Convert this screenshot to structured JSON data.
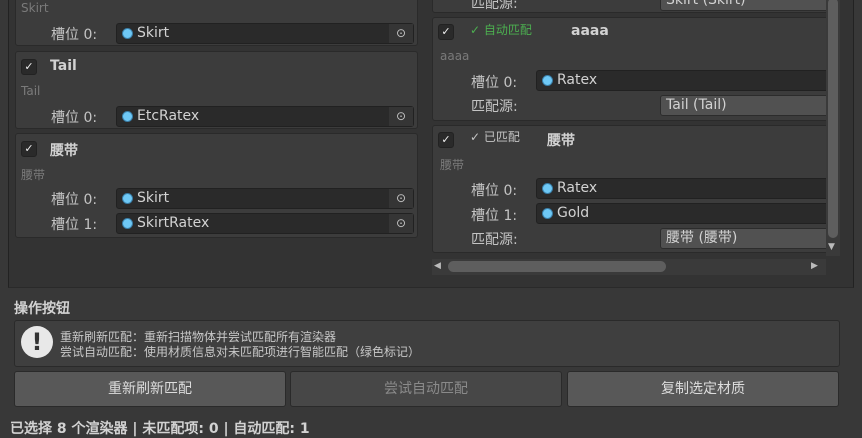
{
  "left": {
    "skirt": {
      "sub": "Skirt",
      "slots": [
        {
          "label": "槽位 0:",
          "value": "Skirt"
        }
      ]
    },
    "tail": {
      "title": "Tail",
      "sub": "Tail",
      "slots": [
        {
          "label": "槽位 0:",
          "value": "EtcRatex"
        }
      ]
    },
    "belt": {
      "title": "腰带",
      "sub": "腰带",
      "slots": [
        {
          "label": "槽位 0:",
          "value": "Skirt"
        },
        {
          "label": "槽位 1:",
          "value": "SkirtRatex"
        }
      ]
    }
  },
  "right": {
    "top": {
      "source_label": "匹配源:",
      "source": "Skirt (Skirt)"
    },
    "aaaa": {
      "status": "✓ 自动匹配",
      "status_color": "#4caf50",
      "title": "aaaa",
      "sub": "aaaa",
      "slots": [
        {
          "label": "槽位 0:",
          "value": "Ratex"
        }
      ],
      "source_label": "匹配源:",
      "source": "Tail (Tail)"
    },
    "belt": {
      "status": "✓ 已匹配",
      "title": "腰带",
      "sub": "腰带",
      "slots": [
        {
          "label": "槽位 0:",
          "value": "Ratex"
        },
        {
          "label": "槽位 1:",
          "value": "Gold"
        }
      ],
      "source_label": "匹配源:",
      "source": "腰带 (腰带)"
    }
  },
  "actions": {
    "heading": "操作按钮",
    "help_line1": "重新刷新匹配：重新扫描物体并尝试匹配所有渲染器",
    "help_line2": "尝试自动匹配：使用材质信息对未匹配项进行智能匹配（绿色标记）",
    "refresh": "重新刷新匹配",
    "auto": "尝试自动匹配",
    "copy": "复制选定材质"
  },
  "status": "已选择 8 个渲染器 | 未匹配项: 0 | 自动匹配: 1"
}
